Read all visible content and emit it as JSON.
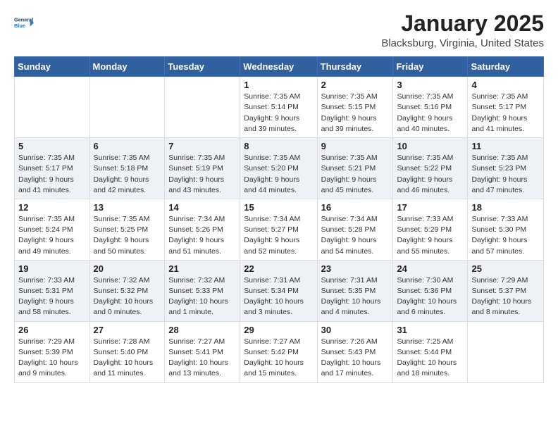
{
  "header": {
    "logo_line1": "General",
    "logo_line2": "Blue",
    "title": "January 2025",
    "subtitle": "Blacksburg, Virginia, United States"
  },
  "days_of_week": [
    "Sunday",
    "Monday",
    "Tuesday",
    "Wednesday",
    "Thursday",
    "Friday",
    "Saturday"
  ],
  "weeks": [
    [
      {
        "num": "",
        "info": ""
      },
      {
        "num": "",
        "info": ""
      },
      {
        "num": "",
        "info": ""
      },
      {
        "num": "1",
        "info": "Sunrise: 7:35 AM\nSunset: 5:14 PM\nDaylight: 9 hours\nand 39 minutes."
      },
      {
        "num": "2",
        "info": "Sunrise: 7:35 AM\nSunset: 5:15 PM\nDaylight: 9 hours\nand 39 minutes."
      },
      {
        "num": "3",
        "info": "Sunrise: 7:35 AM\nSunset: 5:16 PM\nDaylight: 9 hours\nand 40 minutes."
      },
      {
        "num": "4",
        "info": "Sunrise: 7:35 AM\nSunset: 5:17 PM\nDaylight: 9 hours\nand 41 minutes."
      }
    ],
    [
      {
        "num": "5",
        "info": "Sunrise: 7:35 AM\nSunset: 5:17 PM\nDaylight: 9 hours\nand 41 minutes."
      },
      {
        "num": "6",
        "info": "Sunrise: 7:35 AM\nSunset: 5:18 PM\nDaylight: 9 hours\nand 42 minutes."
      },
      {
        "num": "7",
        "info": "Sunrise: 7:35 AM\nSunset: 5:19 PM\nDaylight: 9 hours\nand 43 minutes."
      },
      {
        "num": "8",
        "info": "Sunrise: 7:35 AM\nSunset: 5:20 PM\nDaylight: 9 hours\nand 44 minutes."
      },
      {
        "num": "9",
        "info": "Sunrise: 7:35 AM\nSunset: 5:21 PM\nDaylight: 9 hours\nand 45 minutes."
      },
      {
        "num": "10",
        "info": "Sunrise: 7:35 AM\nSunset: 5:22 PM\nDaylight: 9 hours\nand 46 minutes."
      },
      {
        "num": "11",
        "info": "Sunrise: 7:35 AM\nSunset: 5:23 PM\nDaylight: 9 hours\nand 47 minutes."
      }
    ],
    [
      {
        "num": "12",
        "info": "Sunrise: 7:35 AM\nSunset: 5:24 PM\nDaylight: 9 hours\nand 49 minutes."
      },
      {
        "num": "13",
        "info": "Sunrise: 7:35 AM\nSunset: 5:25 PM\nDaylight: 9 hours\nand 50 minutes."
      },
      {
        "num": "14",
        "info": "Sunrise: 7:34 AM\nSunset: 5:26 PM\nDaylight: 9 hours\nand 51 minutes."
      },
      {
        "num": "15",
        "info": "Sunrise: 7:34 AM\nSunset: 5:27 PM\nDaylight: 9 hours\nand 52 minutes."
      },
      {
        "num": "16",
        "info": "Sunrise: 7:34 AM\nSunset: 5:28 PM\nDaylight: 9 hours\nand 54 minutes."
      },
      {
        "num": "17",
        "info": "Sunrise: 7:33 AM\nSunset: 5:29 PM\nDaylight: 9 hours\nand 55 minutes."
      },
      {
        "num": "18",
        "info": "Sunrise: 7:33 AM\nSunset: 5:30 PM\nDaylight: 9 hours\nand 57 minutes."
      }
    ],
    [
      {
        "num": "19",
        "info": "Sunrise: 7:33 AM\nSunset: 5:31 PM\nDaylight: 9 hours\nand 58 minutes."
      },
      {
        "num": "20",
        "info": "Sunrise: 7:32 AM\nSunset: 5:32 PM\nDaylight: 10 hours\nand 0 minutes."
      },
      {
        "num": "21",
        "info": "Sunrise: 7:32 AM\nSunset: 5:33 PM\nDaylight: 10 hours\nand 1 minute."
      },
      {
        "num": "22",
        "info": "Sunrise: 7:31 AM\nSunset: 5:34 PM\nDaylight: 10 hours\nand 3 minutes."
      },
      {
        "num": "23",
        "info": "Sunrise: 7:31 AM\nSunset: 5:35 PM\nDaylight: 10 hours\nand 4 minutes."
      },
      {
        "num": "24",
        "info": "Sunrise: 7:30 AM\nSunset: 5:36 PM\nDaylight: 10 hours\nand 6 minutes."
      },
      {
        "num": "25",
        "info": "Sunrise: 7:29 AM\nSunset: 5:37 PM\nDaylight: 10 hours\nand 8 minutes."
      }
    ],
    [
      {
        "num": "26",
        "info": "Sunrise: 7:29 AM\nSunset: 5:39 PM\nDaylight: 10 hours\nand 9 minutes."
      },
      {
        "num": "27",
        "info": "Sunrise: 7:28 AM\nSunset: 5:40 PM\nDaylight: 10 hours\nand 11 minutes."
      },
      {
        "num": "28",
        "info": "Sunrise: 7:27 AM\nSunset: 5:41 PM\nDaylight: 10 hours\nand 13 minutes."
      },
      {
        "num": "29",
        "info": "Sunrise: 7:27 AM\nSunset: 5:42 PM\nDaylight: 10 hours\nand 15 minutes."
      },
      {
        "num": "30",
        "info": "Sunrise: 7:26 AM\nSunset: 5:43 PM\nDaylight: 10 hours\nand 17 minutes."
      },
      {
        "num": "31",
        "info": "Sunrise: 7:25 AM\nSunset: 5:44 PM\nDaylight: 10 hours\nand 18 minutes."
      },
      {
        "num": "",
        "info": ""
      }
    ]
  ]
}
